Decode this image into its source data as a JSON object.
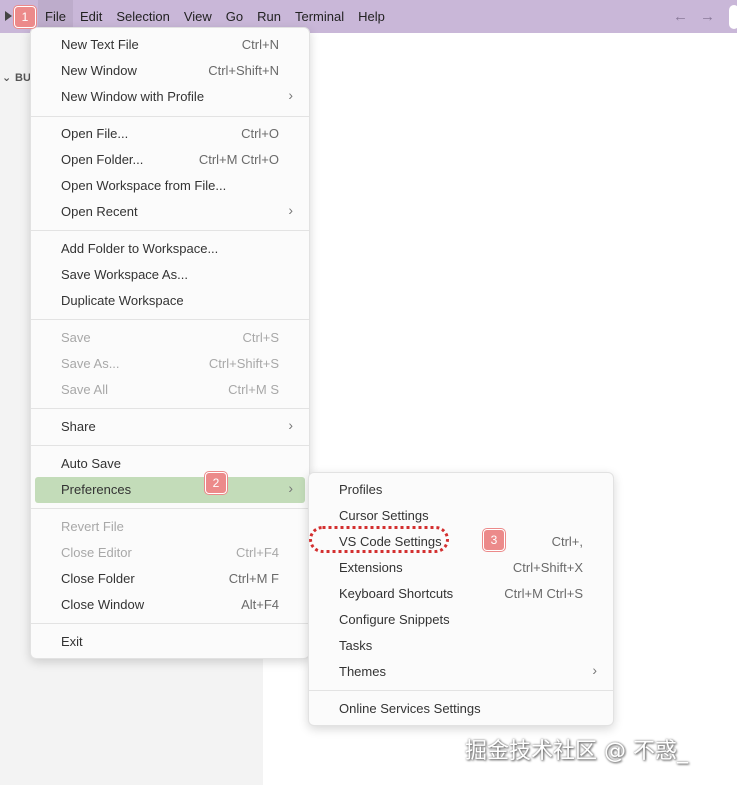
{
  "menubar": [
    "File",
    "Edit",
    "Selection",
    "View",
    "Go",
    "Run",
    "Terminal",
    "Help"
  ],
  "sidebar_label": "BU",
  "file_menu": [
    {
      "label": "New Text File",
      "shortcut": "Ctrl+N"
    },
    {
      "label": "New Window",
      "shortcut": "Ctrl+Shift+N"
    },
    {
      "label": "New Window with Profile",
      "shortcut": ""
    },
    {
      "label": "Open File...",
      "shortcut": "Ctrl+O"
    },
    {
      "label": "Open Folder...",
      "shortcut": "Ctrl+M Ctrl+O"
    },
    {
      "label": "Open Workspace from File...",
      "shortcut": ""
    },
    {
      "label": "Open Recent",
      "shortcut": ""
    },
    {
      "label": "Add Folder to Workspace...",
      "shortcut": ""
    },
    {
      "label": "Save Workspace As...",
      "shortcut": ""
    },
    {
      "label": "Duplicate Workspace",
      "shortcut": ""
    },
    {
      "label": "Save",
      "shortcut": "Ctrl+S"
    },
    {
      "label": "Save As...",
      "shortcut": "Ctrl+Shift+S"
    },
    {
      "label": "Save All",
      "shortcut": "Ctrl+M S"
    },
    {
      "label": "Share",
      "shortcut": ""
    },
    {
      "label": "Auto Save",
      "shortcut": ""
    },
    {
      "label": "Preferences",
      "shortcut": ""
    },
    {
      "label": "Revert File",
      "shortcut": ""
    },
    {
      "label": "Close Editor",
      "shortcut": "Ctrl+F4"
    },
    {
      "label": "Close Folder",
      "shortcut": "Ctrl+M F"
    },
    {
      "label": "Close Window",
      "shortcut": "Alt+F4"
    },
    {
      "label": "Exit",
      "shortcut": ""
    }
  ],
  "preferences_menu": [
    {
      "label": "Profiles",
      "shortcut": ""
    },
    {
      "label": "Cursor Settings",
      "shortcut": ""
    },
    {
      "label": "VS Code Settings",
      "shortcut": "Ctrl+,"
    },
    {
      "label": "Extensions",
      "shortcut": "Ctrl+Shift+X"
    },
    {
      "label": "Keyboard Shortcuts",
      "shortcut": "Ctrl+M Ctrl+S"
    },
    {
      "label": "Configure Snippets",
      "shortcut": ""
    },
    {
      "label": "Tasks",
      "shortcut": ""
    },
    {
      "label": "Themes",
      "shortcut": ""
    },
    {
      "label": "Online Services Settings",
      "shortcut": ""
    }
  ],
  "annotations": {
    "step1": "1",
    "step2": "2",
    "step3": "3"
  },
  "watermark": "掘金技术社区 @ 不惑_",
  "colors": {
    "titlebar": "#c9b7d8",
    "highlight": "#c3dcb9",
    "badge": "#ec8a8a",
    "dotted_outline": "#d32f2f"
  }
}
